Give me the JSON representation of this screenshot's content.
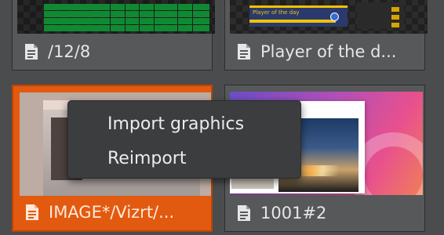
{
  "cards": [
    {
      "id": "card-1",
      "label": "/12/8",
      "thumbnail": "sports-table"
    },
    {
      "id": "card-2",
      "label": "Player of the d...",
      "thumbnail": "player-of-the-day",
      "thumb_text": "Player of the day"
    },
    {
      "id": "card-3",
      "label": "IMAGE*/Vizrt/...",
      "thumbnail": "image",
      "selected": true
    },
    {
      "id": "card-4",
      "label": "1001#2",
      "thumbnail": "image"
    }
  ],
  "context_menu": {
    "items": [
      {
        "label": "Import graphics"
      },
      {
        "label": "Reimport"
      }
    ]
  },
  "icons": {
    "card_type": "document-icon"
  },
  "colors": {
    "background": "#4a4c4e",
    "card": "#565859",
    "selected": "#e25a10",
    "menu": "#3c3d3f",
    "text": "#e6e6e6"
  }
}
